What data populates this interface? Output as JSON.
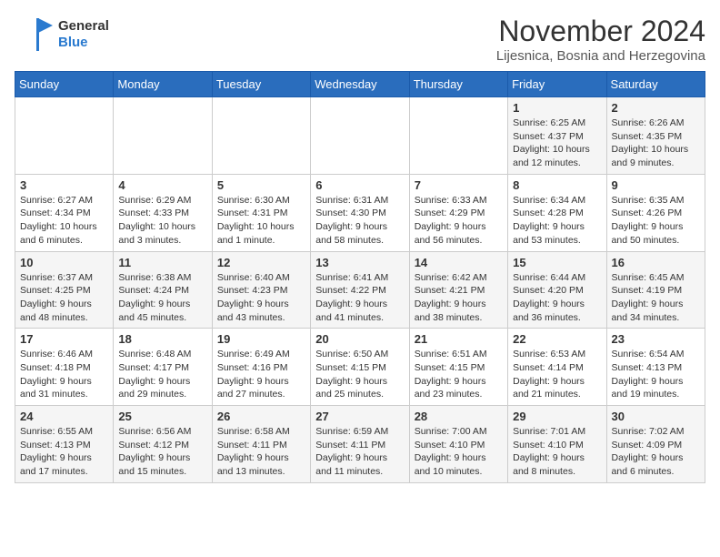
{
  "logo": {
    "line1": "General",
    "line2": "Blue"
  },
  "header": {
    "month": "November 2024",
    "location": "Lijesnica, Bosnia and Herzegovina"
  },
  "weekdays": [
    "Sunday",
    "Monday",
    "Tuesday",
    "Wednesday",
    "Thursday",
    "Friday",
    "Saturday"
  ],
  "weeks": [
    [
      {
        "day": "",
        "info": ""
      },
      {
        "day": "",
        "info": ""
      },
      {
        "day": "",
        "info": ""
      },
      {
        "day": "",
        "info": ""
      },
      {
        "day": "",
        "info": ""
      },
      {
        "day": "1",
        "info": "Sunrise: 6:25 AM\nSunset: 4:37 PM\nDaylight: 10 hours and 12 minutes."
      },
      {
        "day": "2",
        "info": "Sunrise: 6:26 AM\nSunset: 4:35 PM\nDaylight: 10 hours and 9 minutes."
      }
    ],
    [
      {
        "day": "3",
        "info": "Sunrise: 6:27 AM\nSunset: 4:34 PM\nDaylight: 10 hours and 6 minutes."
      },
      {
        "day": "4",
        "info": "Sunrise: 6:29 AM\nSunset: 4:33 PM\nDaylight: 10 hours and 3 minutes."
      },
      {
        "day": "5",
        "info": "Sunrise: 6:30 AM\nSunset: 4:31 PM\nDaylight: 10 hours and 1 minute."
      },
      {
        "day": "6",
        "info": "Sunrise: 6:31 AM\nSunset: 4:30 PM\nDaylight: 9 hours and 58 minutes."
      },
      {
        "day": "7",
        "info": "Sunrise: 6:33 AM\nSunset: 4:29 PM\nDaylight: 9 hours and 56 minutes."
      },
      {
        "day": "8",
        "info": "Sunrise: 6:34 AM\nSunset: 4:28 PM\nDaylight: 9 hours and 53 minutes."
      },
      {
        "day": "9",
        "info": "Sunrise: 6:35 AM\nSunset: 4:26 PM\nDaylight: 9 hours and 50 minutes."
      }
    ],
    [
      {
        "day": "10",
        "info": "Sunrise: 6:37 AM\nSunset: 4:25 PM\nDaylight: 9 hours and 48 minutes."
      },
      {
        "day": "11",
        "info": "Sunrise: 6:38 AM\nSunset: 4:24 PM\nDaylight: 9 hours and 45 minutes."
      },
      {
        "day": "12",
        "info": "Sunrise: 6:40 AM\nSunset: 4:23 PM\nDaylight: 9 hours and 43 minutes."
      },
      {
        "day": "13",
        "info": "Sunrise: 6:41 AM\nSunset: 4:22 PM\nDaylight: 9 hours and 41 minutes."
      },
      {
        "day": "14",
        "info": "Sunrise: 6:42 AM\nSunset: 4:21 PM\nDaylight: 9 hours and 38 minutes."
      },
      {
        "day": "15",
        "info": "Sunrise: 6:44 AM\nSunset: 4:20 PM\nDaylight: 9 hours and 36 minutes."
      },
      {
        "day": "16",
        "info": "Sunrise: 6:45 AM\nSunset: 4:19 PM\nDaylight: 9 hours and 34 minutes."
      }
    ],
    [
      {
        "day": "17",
        "info": "Sunrise: 6:46 AM\nSunset: 4:18 PM\nDaylight: 9 hours and 31 minutes."
      },
      {
        "day": "18",
        "info": "Sunrise: 6:48 AM\nSunset: 4:17 PM\nDaylight: 9 hours and 29 minutes."
      },
      {
        "day": "19",
        "info": "Sunrise: 6:49 AM\nSunset: 4:16 PM\nDaylight: 9 hours and 27 minutes."
      },
      {
        "day": "20",
        "info": "Sunrise: 6:50 AM\nSunset: 4:15 PM\nDaylight: 9 hours and 25 minutes."
      },
      {
        "day": "21",
        "info": "Sunrise: 6:51 AM\nSunset: 4:15 PM\nDaylight: 9 hours and 23 minutes."
      },
      {
        "day": "22",
        "info": "Sunrise: 6:53 AM\nSunset: 4:14 PM\nDaylight: 9 hours and 21 minutes."
      },
      {
        "day": "23",
        "info": "Sunrise: 6:54 AM\nSunset: 4:13 PM\nDaylight: 9 hours and 19 minutes."
      }
    ],
    [
      {
        "day": "24",
        "info": "Sunrise: 6:55 AM\nSunset: 4:13 PM\nDaylight: 9 hours and 17 minutes."
      },
      {
        "day": "25",
        "info": "Sunrise: 6:56 AM\nSunset: 4:12 PM\nDaylight: 9 hours and 15 minutes."
      },
      {
        "day": "26",
        "info": "Sunrise: 6:58 AM\nSunset: 4:11 PM\nDaylight: 9 hours and 13 minutes."
      },
      {
        "day": "27",
        "info": "Sunrise: 6:59 AM\nSunset: 4:11 PM\nDaylight: 9 hours and 11 minutes."
      },
      {
        "day": "28",
        "info": "Sunrise: 7:00 AM\nSunset: 4:10 PM\nDaylight: 9 hours and 10 minutes."
      },
      {
        "day": "29",
        "info": "Sunrise: 7:01 AM\nSunset: 4:10 PM\nDaylight: 9 hours and 8 minutes."
      },
      {
        "day": "30",
        "info": "Sunrise: 7:02 AM\nSunset: 4:09 PM\nDaylight: 9 hours and 6 minutes."
      }
    ]
  ]
}
